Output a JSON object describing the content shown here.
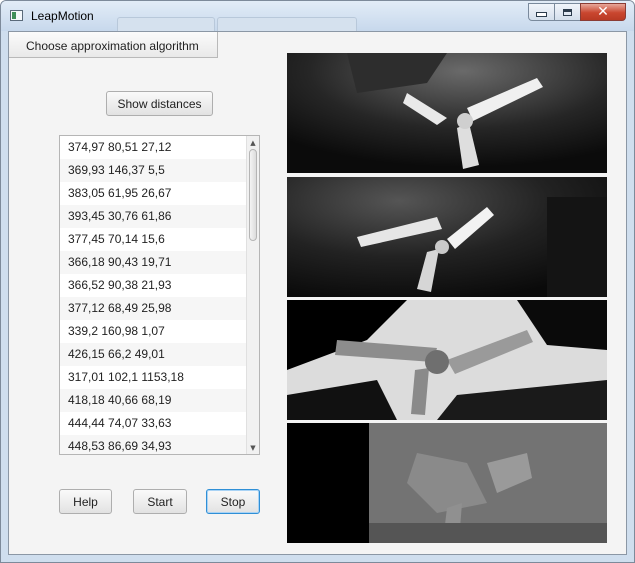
{
  "window": {
    "title": "LeapMotion",
    "controls": {
      "minimize": "minimize-icon",
      "maximize": "maximize-icon",
      "close": "close-icon"
    }
  },
  "menu": {
    "item": "Choose approximation algorithm"
  },
  "buttons": {
    "show_distances": "Show distances",
    "help": "Help",
    "start": "Start",
    "stop": "Stop"
  },
  "distances": [
    "374,97 80,51 27,12",
    "369,93 146,37 5,5",
    "383,05 61,95 26,67",
    "393,45 30,76 61,86",
    "377,45 70,14 15,6",
    "366,18 90,43 19,71",
    "366,52 90,38 21,93",
    "377,12 68,49 25,98",
    "339,2 160,98 1,07",
    "426,15 66,2 49,01",
    "317,01 102,1 1153,18",
    "418,18 40,66 68,19",
    "444,44 74,07 33,63",
    "448,53 86,69 34,93"
  ],
  "images": [
    {
      "name": "left-camera-image"
    },
    {
      "name": "right-camera-image"
    },
    {
      "name": "processed-image"
    },
    {
      "name": "depth-map-image"
    }
  ],
  "colors": {
    "window_frame": "#cfdeee",
    "close_button": "#c9462f",
    "focus_border": "#2f8fd6",
    "client_bg": "#f4f4f4"
  }
}
